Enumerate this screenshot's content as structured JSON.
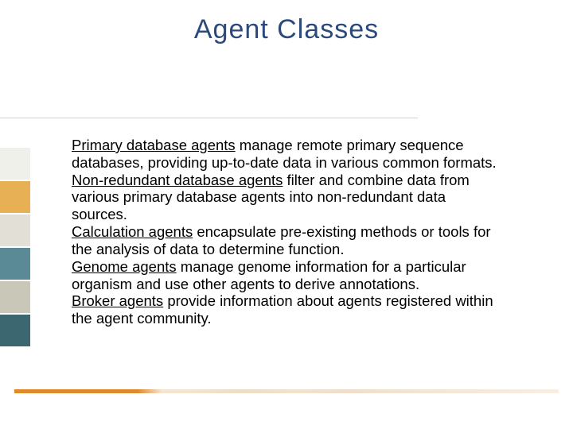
{
  "title": "Agent Classes",
  "items": [
    {
      "label": "Primary database agents",
      "text": " manage remote primary sequence databases, providing up-to-date data in various common formats."
    },
    {
      "label": "Non-redundant database agents",
      "text": " filter and combine data from various primary database agents into non-redundant data sources."
    },
    {
      "label": "Calculation agents",
      "text": " encapsulate pre-existing methods or tools for the analysis of data to determine function."
    },
    {
      "label": "Genome agents",
      "text": " manage genome information for a particular organism and use other agents to derive annotations."
    },
    {
      "label": "Broker agents",
      "text": " provide information about agents registered within the agent community."
    }
  ],
  "colors": {
    "title": "#2b4a7a",
    "accent_orange": "#e08a2a",
    "block_palette": [
      "#f0f0ea",
      "#e8b054",
      "#e2e0d6",
      "#5a8a95",
      "#c9c7b8",
      "#3d6770"
    ]
  }
}
